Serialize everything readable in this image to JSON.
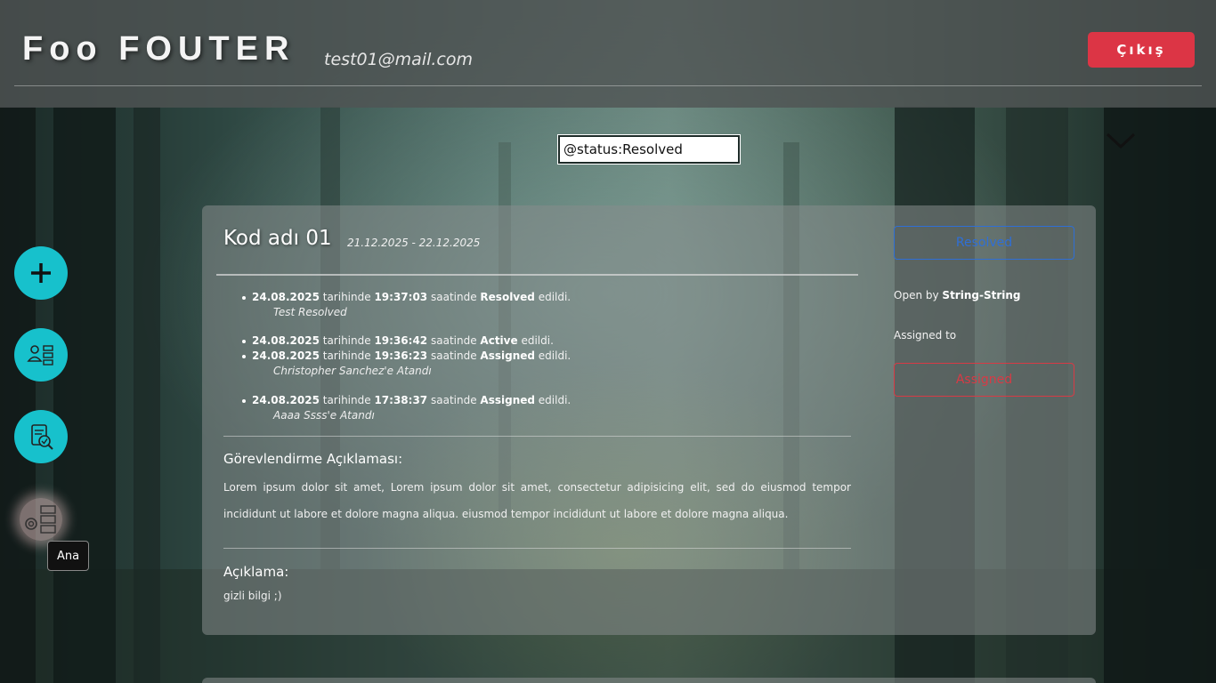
{
  "header": {
    "brand": "Foo FOUTER",
    "user_email": "test01@mail.com",
    "logout_label": "Çıkış"
  },
  "search": {
    "value": "@status:Resolved"
  },
  "sidebar": {
    "items": [
      {
        "icon": "plus-icon"
      },
      {
        "icon": "user-list-icon"
      },
      {
        "icon": "document-check-icon"
      },
      {
        "icon": "settings-list-icon"
      }
    ],
    "tooltip": "Ana"
  },
  "card": {
    "title": "Kod adı 01",
    "date_range": "21.12.2025 - 22.12.2025",
    "history": [
      {
        "date": "24.08.2025",
        "mid1": "tarihinde",
        "time": "19:37:03",
        "mid2": "saatinde",
        "status": "Resolved",
        "end": "edildi.",
        "note": "Test Resolved"
      },
      {
        "date": "24.08.2025",
        "mid1": "tarihinde",
        "time": "19:36:42",
        "mid2": "saatinde",
        "status": "Active",
        "end": "edildi.",
        "note": ""
      },
      {
        "date": "24.08.2025",
        "mid1": "tarihinde",
        "time": "19:36:23",
        "mid2": "saatinde",
        "status": "Assigned",
        "end": "edildi.",
        "note": "Christopher Sanchez'e Atandı"
      },
      {
        "date": "24.08.2025",
        "mid1": "tarihinde",
        "time": "17:38:37",
        "mid2": "saatinde",
        "status": "Assigned",
        "end": "edildi.",
        "note": "Aaaa Ssss'e Atandı"
      }
    ],
    "assignment_title": "Görevlendirme Açıklaması:",
    "assignment_text": "Lorem ipsum dolor sit amet, Lorem ipsum dolor sit amet, consectetur adipisicing elit, sed do eiusmod tempor incididunt ut labore et dolore magna aliqua. eiusmod tempor incididunt ut labore et dolore magna aliqua.",
    "description_title": "Açıklama:",
    "description_text": "gizli bilgi ;)",
    "status_label": "Resolved",
    "status_color": "#2f6fd6",
    "open_by_prefix": "Open by",
    "open_by_user": "String-String",
    "assigned_to_label": "Assigned to",
    "assigned_label": "Assigned",
    "assigned_color": "#d83a45"
  },
  "colors": {
    "accent": "#17c1cc",
    "logout": "#dc3545"
  }
}
